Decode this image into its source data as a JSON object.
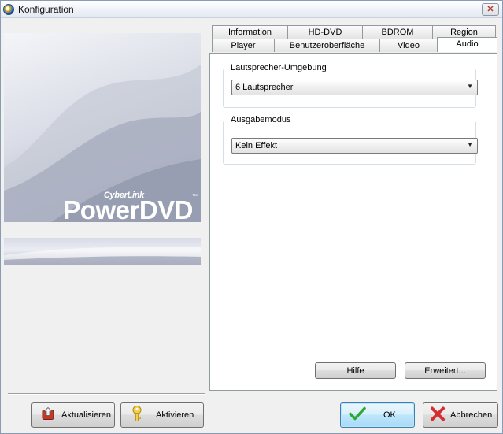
{
  "window": {
    "title": "Konfiguration",
    "close_label": "✕"
  },
  "logo": {
    "brand_small": "CyberLink",
    "brand_large": "PowerDVD",
    "trademark": "™"
  },
  "tabs": {
    "row1": [
      {
        "label": "Information"
      },
      {
        "label": "HD-DVD"
      },
      {
        "label": "BDROM"
      },
      {
        "label": "Region"
      }
    ],
    "row2": [
      {
        "label": "Player"
      },
      {
        "label": "Benutzeroberfläche"
      },
      {
        "label": "Video"
      },
      {
        "label": "Audio",
        "active": true
      }
    ]
  },
  "audio": {
    "speaker_group_label": "Lautsprecher-Umgebung",
    "speaker_value": "6 Lautsprecher",
    "output_group_label": "Ausgabemodus",
    "output_value": "Kein Effekt",
    "dropdown_arrow": "▼"
  },
  "buttons": {
    "help": "Hilfe",
    "advanced": "Erweitert...",
    "update": "Aktualisieren",
    "activate": "Aktivieren",
    "ok": "OK",
    "cancel": "Abbrechen"
  },
  "icons": {
    "update": "update-icon",
    "activate": "key-icon",
    "ok": "checkmark-icon",
    "cancel": "x-icon"
  }
}
